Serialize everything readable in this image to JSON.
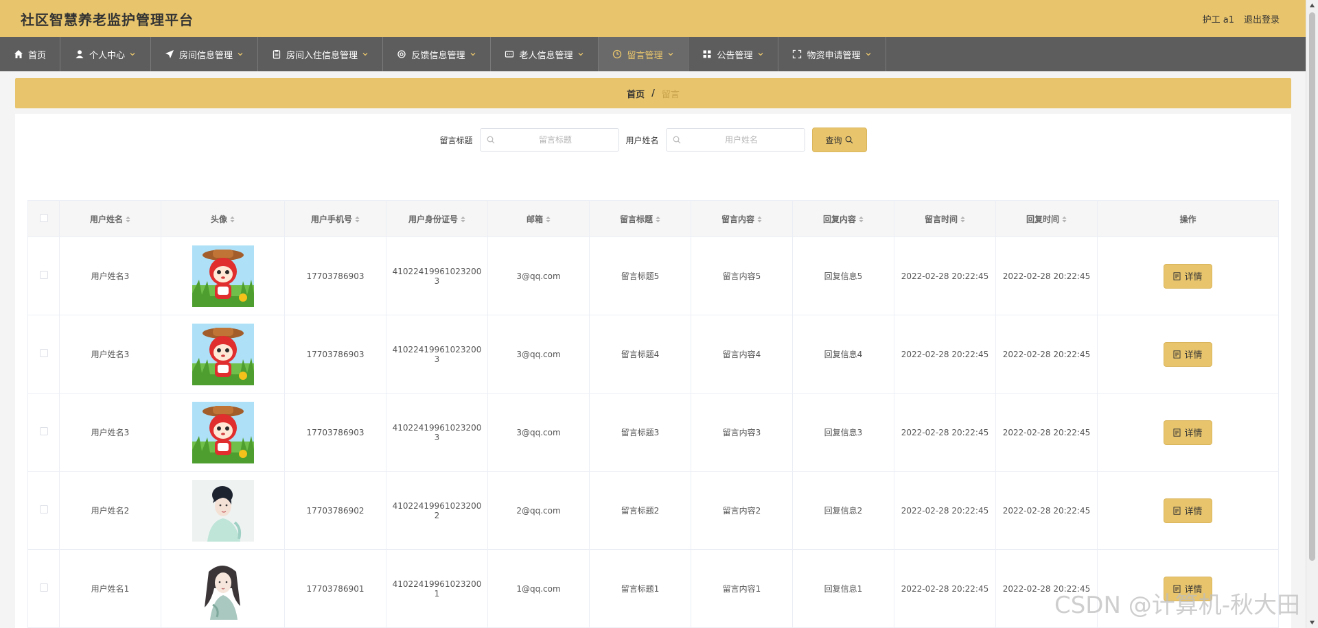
{
  "app": {
    "title": "社区智慧养老监护管理平台"
  },
  "header": {
    "user": "护工 a1",
    "logout": "退出登录"
  },
  "nav": {
    "items": [
      {
        "label": "首页",
        "icon": "home-icon"
      },
      {
        "label": "个人中心",
        "icon": "person-icon"
      },
      {
        "label": "房间信息管理",
        "icon": "send-icon"
      },
      {
        "label": "房间入住信息管理",
        "icon": "clipboard-icon"
      },
      {
        "label": "反馈信息管理",
        "icon": "settings-icon"
      },
      {
        "label": "老人信息管理",
        "icon": "message-icon"
      },
      {
        "label": "留言管理",
        "icon": "clock-icon"
      },
      {
        "label": "公告管理",
        "icon": "grid-icon"
      },
      {
        "label": "物资申请管理",
        "icon": "fullscreen-icon"
      }
    ]
  },
  "breadcrumb": {
    "home": "首页",
    "separator": "/",
    "current": "留言"
  },
  "search": {
    "title_label": "留言标题",
    "title_placeholder": "留言标题",
    "user_label": "用户姓名",
    "user_placeholder": "用户姓名",
    "button": "查询"
  },
  "table": {
    "headers": [
      "用户姓名",
      "头像",
      "用户手机号",
      "用户身份证号",
      "邮箱",
      "留言标题",
      "留言内容",
      "回复内容",
      "留言时间",
      "回复时间",
      "操作"
    ],
    "rows": [
      {
        "name": "用户姓名3",
        "avatar": "cartoon-fox-avatar",
        "phone": "17703786903",
        "idcard": "410224199610232003",
        "email": "3@qq.com",
        "title": "留言标题5",
        "content": "留言内容5",
        "reply": "回复信息5",
        "time": "2022-02-28 20:22:45",
        "reply_time": "2022-02-28 20:22:45",
        "action": "详情"
      },
      {
        "name": "用户姓名3",
        "avatar": "cartoon-fox-avatar",
        "phone": "17703786903",
        "idcard": "410224199610232003",
        "email": "3@qq.com",
        "title": "留言标题4",
        "content": "留言内容4",
        "reply": "回复信息4",
        "time": "2022-02-28 20:22:45",
        "reply_time": "2022-02-28 20:22:45",
        "action": "详情"
      },
      {
        "name": "用户姓名3",
        "avatar": "cartoon-fox-avatar",
        "phone": "17703786903",
        "idcard": "410224199610232003",
        "email": "3@qq.com",
        "title": "留言标题3",
        "content": "留言内容3",
        "reply": "回复信息3",
        "time": "2022-02-28 20:22:45",
        "reply_time": "2022-02-28 20:22:45",
        "action": "详情"
      },
      {
        "name": "用户姓名2",
        "avatar": "woman-photo-avatar",
        "phone": "17703786902",
        "idcard": "410224199610232002",
        "email": "2@qq.com",
        "title": "留言标题2",
        "content": "留言内容2",
        "reply": "回复信息2",
        "time": "2022-02-28 20:22:45",
        "reply_time": "2022-02-28 20:22:45",
        "action": "详情"
      },
      {
        "name": "用户姓名1",
        "avatar": "woman-illustration-avatar",
        "phone": "17703786901",
        "idcard": "410224199610232001",
        "email": "1@qq.com",
        "title": "留言标题1",
        "content": "留言内容1",
        "reply": "回复信息1",
        "time": "2022-02-28 20:22:45",
        "reply_time": "2022-02-28 20:22:45",
        "action": "详情"
      }
    ]
  },
  "watermark": "CSDN @计算机-秋大田",
  "colors": {
    "accent": "#e8c56d",
    "nav": "#5d5d5d",
    "active": "#e8c56d"
  }
}
